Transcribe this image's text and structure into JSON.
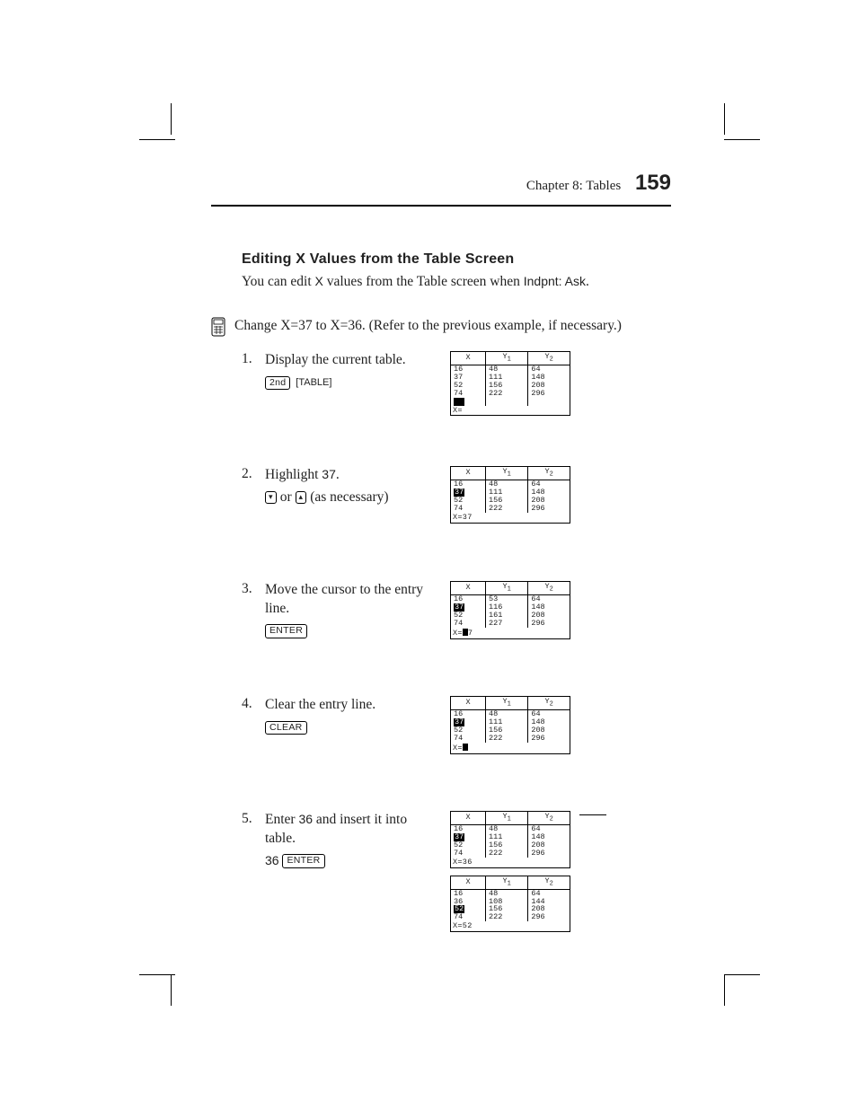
{
  "header": {
    "chapter": "Chapter 8: Tables",
    "page": "159"
  },
  "section": {
    "title": "Editing X Values from the Table Screen",
    "intro_pre": "You can edit ",
    "intro_var": "X",
    "intro_mid": " values from the Table screen when ",
    "intro_cond": "Indpnt: Ask",
    "intro_post": "."
  },
  "example": {
    "lead": "Change X=37 to X=36. (Refer to the previous example, if necessary.)"
  },
  "steps": [
    {
      "num": "1.",
      "text": "Display the current table.",
      "keys": [
        {
          "type": "box",
          "label": "2nd"
        },
        {
          "type": "bracket",
          "label": "[TABLE]"
        }
      ],
      "screen": {
        "cols": [
          "X",
          "Y1",
          "Y2"
        ],
        "rows": [
          [
            "16",
            "48",
            "64"
          ],
          [
            "37",
            "111",
            "148"
          ],
          [
            "52",
            "156",
            "208"
          ],
          [
            "74",
            "222",
            "296"
          ]
        ],
        "highlight_row": -1,
        "bottom_cursor_cell": true,
        "status": "X="
      }
    },
    {
      "num": "2.",
      "text_pre": "Highlight ",
      "text_em": "37",
      "text_post": ".",
      "keys": [
        {
          "type": "arrow",
          "label": "▾"
        },
        {
          "type": "text",
          "label": " or "
        },
        {
          "type": "arrow",
          "label": "▴"
        },
        {
          "type": "text",
          "label": "  (as necessary)"
        }
      ],
      "screen": {
        "cols": [
          "X",
          "Y1",
          "Y2"
        ],
        "rows": [
          [
            "16",
            "48",
            "64"
          ],
          [
            "37",
            "111",
            "148"
          ],
          [
            "52",
            "156",
            "208"
          ],
          [
            "74",
            "222",
            "296"
          ]
        ],
        "highlight_row": 1,
        "status": "X=37"
      }
    },
    {
      "num": "3.",
      "text": "Move the cursor to the entry line.",
      "keys": [
        {
          "type": "box",
          "label": "ENTER"
        }
      ],
      "screen": {
        "cols": [
          "X",
          "Y1",
          "Y2"
        ],
        "rows": [
          [
            "16",
            "53",
            "64"
          ],
          [
            "37",
            "116",
            "148"
          ],
          [
            "52",
            "161",
            "208"
          ],
          [
            "74",
            "227",
            "296"
          ]
        ],
        "highlight_row": 1,
        "status_pre": "X=",
        "status_cursor": true,
        "status_post": "7"
      }
    },
    {
      "num": "4.",
      "text": "Clear the entry line.",
      "keys": [
        {
          "type": "box",
          "label": "CLEAR"
        }
      ],
      "screen": {
        "cols": [
          "X",
          "Y1",
          "Y2"
        ],
        "rows": [
          [
            "16",
            "48",
            "64"
          ],
          [
            "37",
            "111",
            "148"
          ],
          [
            "52",
            "156",
            "208"
          ],
          [
            "74",
            "222",
            "296"
          ]
        ],
        "highlight_row": 1,
        "status_pre": "X=",
        "status_cursor": true
      }
    },
    {
      "num": "5.",
      "text_pre": "Enter ",
      "text_em": "36",
      "text_post": " and insert it into table.",
      "keys": [
        {
          "type": "plain",
          "label": "36 "
        },
        {
          "type": "box",
          "label": "ENTER"
        }
      ],
      "screen": {
        "cols": [
          "X",
          "Y1",
          "Y2"
        ],
        "rows": [
          [
            "16",
            "48",
            "64"
          ],
          [
            "37",
            "111",
            "148"
          ],
          [
            "52",
            "156",
            "208"
          ],
          [
            "74",
            "222",
            "296"
          ]
        ],
        "highlight_row": 1,
        "status": "X=36"
      },
      "screen2": {
        "cols": [
          "X",
          "Y1",
          "Y2"
        ],
        "rows": [
          [
            "16",
            "48",
            "64"
          ],
          [
            "36",
            "108",
            "144"
          ],
          [
            "52",
            "156",
            "208"
          ],
          [
            "74",
            "222",
            "296"
          ]
        ],
        "highlight_row": 2,
        "status": "X=52"
      }
    }
  ]
}
